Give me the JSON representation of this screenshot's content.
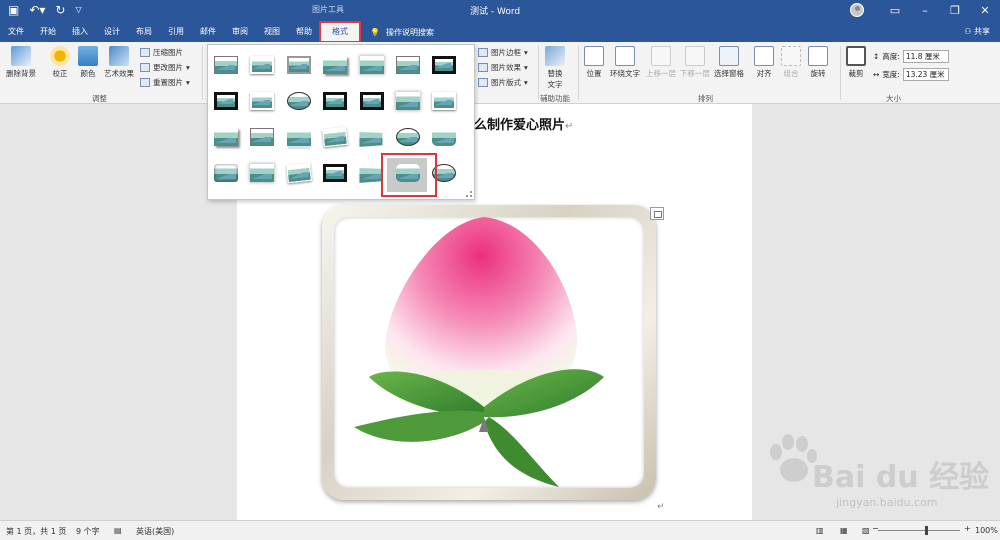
{
  "app": {
    "context_tab_label": "图片工具",
    "doc_title": "测试 - Word",
    "qat": {
      "save_icon": "save-icon",
      "undo_icon": "undo-icon",
      "redo_icon": "redo-icon",
      "customize": "▽"
    },
    "share_label": "共享"
  },
  "tabs": [
    "文件",
    "开始",
    "插入",
    "设计",
    "布局",
    "引用",
    "邮件",
    "审阅",
    "视图",
    "帮助",
    "格式"
  ],
  "active_tab": "格式",
  "tell_me": "操作说明搜索",
  "ribbon": {
    "remove_bg": "删除背景",
    "corrections": "校正",
    "color": "颜色",
    "artistic": "艺术效果",
    "compress": "压缩图片",
    "change_pic": "更改图片",
    "reset_pic": "重置图片",
    "adjust_group": "调整",
    "pic_border": "图片边框",
    "pic_effects": "图片效果",
    "pic_layout": "图片版式",
    "alt_text_1": "替换",
    "alt_text_2": "文字",
    "accessibility_group": "辅助功能",
    "position": "位置",
    "wrap_text": "环绕文字",
    "bring_forward": "上移一层",
    "send_backward": "下移一层",
    "selection_pane": "选择窗格",
    "align": "对齐",
    "group": "组合",
    "rotate": "旋转",
    "arrange_group": "排列",
    "crop": "裁剪",
    "height_label": "高度:",
    "height_value": "11.8 厘米",
    "width_label": "宽度:",
    "width_value": "13.23 厘米",
    "size_group": "大小"
  },
  "document": {
    "heading": "么制作爱心照片",
    "para_mark": "↵"
  },
  "gallery": {
    "selected_index": 26
  },
  "status": {
    "page": "第 1 页，共 1 页",
    "words": "9 个字",
    "language": "英语(美国)",
    "zoom": "100%",
    "zoom_minus": "−",
    "zoom_plus": "+"
  },
  "watermark": {
    "text": "Bai du 经验",
    "url": "jingyan.baidu.com"
  },
  "colors": {
    "title_bar": "#2b579a",
    "ribbon_bg": "#f3f3f3",
    "highlight_red": "#d9383a"
  }
}
